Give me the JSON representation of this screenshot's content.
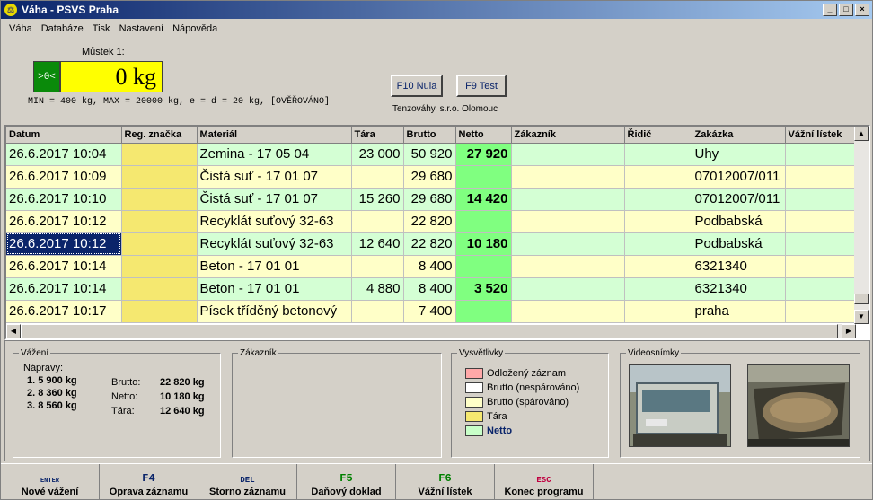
{
  "window": {
    "title": "Váha - PSVS Praha",
    "min": "_",
    "max": "□",
    "close": "×"
  },
  "menu": [
    "Váha",
    "Databáze",
    "Tisk",
    "Nastavení",
    "Nápověda"
  ],
  "scale": {
    "label": "Můstek 1:",
    "zero_indicator": ">0<",
    "weight": "0 kg",
    "limits": "MIN = 400 kg, MAX = 20000 kg, e = d = 20 kg, [OVĚŘOVÁNO]",
    "btn_zero": "F10 Nula",
    "btn_test": "F9 Test",
    "company": "Tenzováhy, s.r.o. Olomouc"
  },
  "table": {
    "headers": [
      "Datum",
      "Reg. značka",
      "Materiál",
      "Tára",
      "Brutto",
      "Netto",
      "Zákazník",
      "Řidič",
      "Zakázka",
      "Vážní lístek"
    ],
    "rows": [
      {
        "datum": "26.6.2017 10:04",
        "reg": "",
        "material": "Zemina - 17 05 04",
        "tara": "23 000",
        "brutto": "50 920",
        "netto": "27 920",
        "zakaznik": "",
        "ridic": "",
        "zakazka": "Uhy",
        "listek": ""
      },
      {
        "datum": "26.6.2017 10:09",
        "reg": "",
        "material": "Čistá suť - 17 01 07",
        "tara": "",
        "brutto": "29 680",
        "netto": "",
        "zakaznik": "",
        "ridic": "",
        "zakazka": "07012007/011",
        "listek": ""
      },
      {
        "datum": "26.6.2017 10:10",
        "reg": "",
        "material": "Čistá suť - 17 01 07",
        "tara": "15 260",
        "brutto": "29 680",
        "netto": "14 420",
        "zakaznik": "",
        "ridic": "",
        "zakazka": "07012007/011",
        "listek": ""
      },
      {
        "datum": "26.6.2017 10:12",
        "reg": "",
        "material": "Recyklát suťový 32-63",
        "tara": "",
        "brutto": "22 820",
        "netto": "",
        "zakaznik": "",
        "ridic": "",
        "zakazka": "Podbabská",
        "listek": ""
      },
      {
        "datum": "26.6.2017 10:12",
        "reg": "",
        "material": "Recyklát suťový 32-63",
        "tara": "12 640",
        "brutto": "22 820",
        "netto": "10 180",
        "zakaznik": "",
        "ridic": "",
        "zakazka": "Podbabská",
        "listek": ""
      },
      {
        "datum": "26.6.2017 10:14",
        "reg": "",
        "material": "Beton - 17 01 01",
        "tara": "",
        "brutto": "8 400",
        "netto": "",
        "zakaznik": "",
        "ridic": "",
        "zakazka": "6321340",
        "listek": ""
      },
      {
        "datum": "26.6.2017 10:14",
        "reg": "",
        "material": "Beton - 17 01 01",
        "tara": "4 880",
        "brutto": "8 400",
        "netto": "3 520",
        "zakaznik": "",
        "ridic": "",
        "zakazka": "6321340",
        "listek": ""
      },
      {
        "datum": "26.6.2017 10:17",
        "reg": "",
        "material": "Písek tříděný betonový",
        "tara": "",
        "brutto": "7 400",
        "netto": "",
        "zakaznik": "",
        "ridic": "",
        "zakazka": "praha",
        "listek": ""
      }
    ]
  },
  "weighing": {
    "title": "Vážení",
    "axles_label": "Nápravy:",
    "axles": [
      "1. 5 900 kg",
      "2. 8 360 kg",
      "3. 8 560 kg"
    ],
    "brutto_label": "Brutto:",
    "brutto": "22 820 kg",
    "netto_label": "Netto:",
    "netto": "10 180 kg",
    "tara_label": "Tára:",
    "tara": "12 640 kg"
  },
  "customer": {
    "title": "Zákazník"
  },
  "legend": {
    "title": "Vysvětlivky",
    "items": [
      {
        "label": "Odložený záznam",
        "color": "#ffa8a8"
      },
      {
        "label": "Brutto (nespárováno)",
        "color": "#ffffff"
      },
      {
        "label": "Brutto (spárováno)",
        "color": "#ffffc8"
      },
      {
        "label": "Tára",
        "color": "#f5e870"
      },
      {
        "label": "Netto",
        "color": "#c8ffc8"
      }
    ]
  },
  "video": {
    "title": "Videosnímky"
  },
  "toolbar": [
    {
      "key": "ENTER",
      "label": "Nové vážení",
      "color": "#0a246a"
    },
    {
      "key": "F4",
      "label": "Oprava záznamu",
      "color": "#0a246a"
    },
    {
      "key": "DEL",
      "label": "Storno záznamu",
      "color": "#0a246a"
    },
    {
      "key": "F5",
      "label": "Daňový doklad",
      "color": "#008000"
    },
    {
      "key": "F6",
      "label": "Vážní lístek",
      "color": "#008000"
    },
    {
      "key": "ESC",
      "label": "Konec programu",
      "color": "#c00040"
    }
  ]
}
